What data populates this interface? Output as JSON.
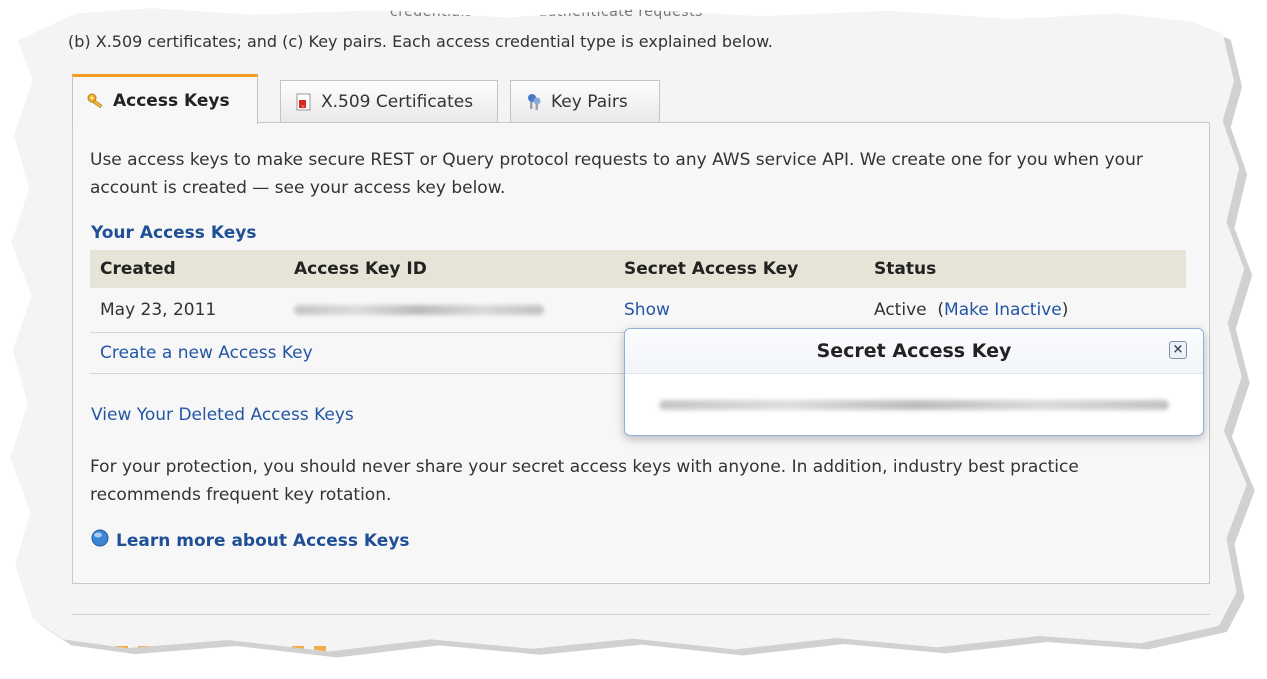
{
  "intro": {
    "top_fragment": "credentials used to authenticate requests",
    "line": "(b) X.509 certificates; and (c) Key pairs. Each access credential type is explained below."
  },
  "tabs": [
    {
      "label": "Access Keys",
      "icon": "key-icon",
      "active": true
    },
    {
      "label": "X.509 Certificates",
      "icon": "certificate-icon",
      "active": false
    },
    {
      "label": "Key Pairs",
      "icon": "key-pair-icon",
      "active": false
    }
  ],
  "panel": {
    "description": "Use access keys to make secure REST or Query protocol requests to any AWS service API. We create one for you when your account is created — see your access key below.",
    "section_title": "Your Access Keys",
    "table": {
      "headers": [
        "Created",
        "Access Key ID",
        "Secret Access Key",
        "Status"
      ],
      "rows": [
        {
          "created": "May 23, 2011",
          "secret_action": "Show",
          "status": "Active",
          "status_action": "Make Inactive"
        }
      ],
      "create_link": "Create a new Access Key"
    },
    "deleted_link": "View Your Deleted Access Keys",
    "protection_note": "For your protection, you should never share your secret access keys with anyone. In addition, industry best practice recommends frequent key rotation.",
    "learn_more": "Learn more about Access Keys"
  },
  "popup": {
    "title": "Secret Access Key",
    "close_glyph": "×"
  },
  "colors": {
    "accent_tab": "#f59b1e",
    "link": "#2255a4",
    "heading_blue": "#1f4f96",
    "table_header": "#e6e4d6"
  }
}
